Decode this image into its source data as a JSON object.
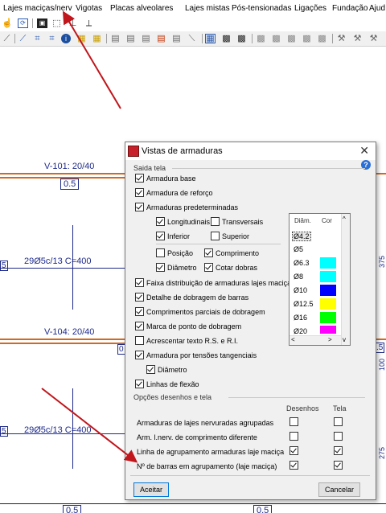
{
  "menu": {
    "items": [
      {
        "label": "Lajes maciças/nerv"
      },
      {
        "label": "Vigotas"
      },
      {
        "label": "Placas alveolares"
      },
      {
        "label": "Lajes mistas"
      },
      {
        "label": "Pós-tensionadas"
      },
      {
        "label": "Ligações"
      },
      {
        "label": "Fundação"
      },
      {
        "label": "Ajud"
      }
    ]
  },
  "drawing": {
    "beam_top": "V-101: 20/40",
    "beam_mid": "V-104: 20/40",
    "dim_top": "0.5",
    "dim_bottom_left": "0.5",
    "dim_bottom_right": "0.5",
    "bar_top": "29Ø5c/13 C=400",
    "bar_bottom": "29Ø5c/13 C=400",
    "edge_left_top": "5",
    "edge_left_bottom": "5",
    "edge_mid_left": "0",
    "edge_right_mid": ".5",
    "side_right_1": "375",
    "side_right_2": "100",
    "side_right_3": "275"
  },
  "dialog": {
    "title": "Vistas de armaduras",
    "section_saida": "Saida tela",
    "armadura_base": "Armadura base",
    "armadura_reforco": "Armadura de reforço",
    "armaduras_predet": "Armaduras predeterminadas",
    "longitudinais": "Longitudinais",
    "transversais": "Transversais",
    "inferior": "Inferior",
    "superior": "Superior",
    "posicao": "Posição",
    "comprimento": "Comprimento",
    "diametro": "Diâmetro",
    "cotar_dobras": "Cotar dobras",
    "faixa": "Faixa distribuição de armaduras lajes maciças",
    "detalhe": "Detalhe de dobragem de barras",
    "comprimentos_parciais": "Comprimentos parciais de dobragem",
    "marca_ponto": "Marca de ponto de dobragem",
    "acrescentar": "Acrescentar texto R.S. e R.I.",
    "tensoes": "Armadura por tensões tangenciais",
    "diametro2": "Diâmetro",
    "linhas_flexao": "Linhas de flexão",
    "table": {
      "col_diam": "Diâm.",
      "col_cor": "Cor",
      "rows": [
        {
          "d": "Ø4.2",
          "color": ""
        },
        {
          "d": "Ø5",
          "color": ""
        },
        {
          "d": "Ø6.3",
          "color": "#00ffff"
        },
        {
          "d": "Ø8",
          "color": "#00ffff"
        },
        {
          "d": "Ø10",
          "color": "#0000ff"
        },
        {
          "d": "Ø12.5",
          "color": "#ffff00"
        },
        {
          "d": "Ø16",
          "color": "#00ff00"
        },
        {
          "d": "Ø20",
          "color": "#ff00ff"
        }
      ]
    },
    "section_opcoes": "Opções desenhos e tela",
    "col_desenhos": "Desenhos",
    "col_tela": "Tela",
    "opt_rows": [
      {
        "label": "Armaduras de lajes nervuradas agrupadas",
        "desenhos": false,
        "tela": false
      },
      {
        "label": "Arm. l.nerv. de comprimento diferente",
        "desenhos": false,
        "tela": false
      },
      {
        "label": "Linha de agrupamento armaduras laje maciça",
        "desenhos": true,
        "tela": true
      },
      {
        "label": "Nº de barras em agrupamento (laje maciça)",
        "desenhos": true,
        "tela": true
      }
    ],
    "btn_ok": "Aceitar",
    "btn_cancel": "Cancelar"
  },
  "colors": {
    "beam_orange": "#d06a22",
    "cad_blue": "#1d2a8a",
    "annotation_red": "#c0161c"
  }
}
